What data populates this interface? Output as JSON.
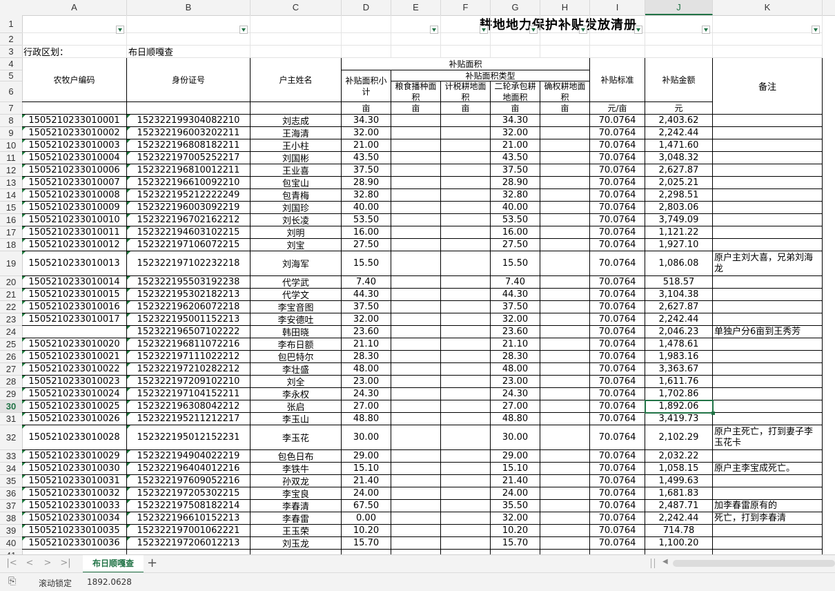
{
  "columns": [
    "A",
    "B",
    "C",
    "D",
    "E",
    "F",
    "G",
    "H",
    "I",
    "J",
    "K"
  ],
  "selected_column": "J",
  "selected_row": "30",
  "title": "耕地地力保护补贴发放清册",
  "region_label": "行政区划：",
  "region_value": "布日顺嘎查",
  "headers": {
    "farmer_code": "农牧户编码",
    "id_number": "身份证号",
    "head_name": "户主姓名",
    "subsidy_area": "补贴面积",
    "area_subtotal": "补贴面积小计",
    "area_type": "补贴面积类型",
    "grain_area": "粮食播种面积",
    "tax_area": "计税耕地面积",
    "contract_area": "二轮承包耕地面积",
    "right_area": "确权耕地面积",
    "standard": "补贴标准",
    "amount": "补贴金额",
    "remark": "备注",
    "unit_mu": "亩",
    "unit_yuan_mu": "元/亩",
    "unit_yuan": "元"
  },
  "rows": [
    {
      "r": "8",
      "code": "1505210233010001",
      "id": "152322199304082210",
      "name": "刘志成",
      "d": "34.30",
      "g": "34.30",
      "i": "70.0764",
      "j": "2,403.62",
      "k": ""
    },
    {
      "r": "9",
      "code": "1505210233010002",
      "id": "152322196003202211",
      "name": "王海清",
      "d": "32.00",
      "g": "32.00",
      "i": "70.0764",
      "j": "2,242.44",
      "k": ""
    },
    {
      "r": "10",
      "code": "1505210233010003",
      "id": "152322196808182211",
      "name": "王小柱",
      "d": "21.00",
      "g": "21.00",
      "i": "70.0764",
      "j": "1,471.60",
      "k": ""
    },
    {
      "r": "11",
      "code": "1505210233010004",
      "id": "152322197005252217",
      "name": "刘国彬",
      "d": "43.50",
      "g": "43.50",
      "i": "70.0764",
      "j": "3,048.32",
      "k": ""
    },
    {
      "r": "12",
      "code": "1505210233010006",
      "id": "152322196810012211",
      "name": "王业喜",
      "d": "37.50",
      "g": "37.50",
      "i": "70.0764",
      "j": "2,627.87",
      "k": ""
    },
    {
      "r": "13",
      "code": "1505210233010007",
      "id": "152322196610092210",
      "name": "包宝山",
      "d": "28.90",
      "g": "28.90",
      "i": "70.0764",
      "j": "2,025.21",
      "k": ""
    },
    {
      "r": "14",
      "code": "1505210233010008",
      "id": "152322195212222249",
      "name": "包青梅",
      "d": "32.80",
      "g": "32.80",
      "i": "70.0764",
      "j": "2,298.51",
      "k": ""
    },
    {
      "r": "15",
      "code": "1505210233010009",
      "id": "152322196003092219",
      "name": "刘国珍",
      "d": "40.00",
      "g": "40.00",
      "i": "70.0764",
      "j": "2,803.06",
      "k": ""
    },
    {
      "r": "16",
      "code": "1505210233010010",
      "id": "152322196702162212",
      "name": "刘长凌",
      "d": "53.50",
      "g": "53.50",
      "i": "70.0764",
      "j": "3,749.09",
      "k": ""
    },
    {
      "r": "17",
      "code": "1505210233010011",
      "id": "152322194603102215",
      "name": "刘明",
      "d": "16.00",
      "g": "16.00",
      "i": "70.0764",
      "j": "1,121.22",
      "k": ""
    },
    {
      "r": "18",
      "code": "1505210233010012",
      "id": "152322197106072215",
      "name": "刘宝",
      "d": "27.50",
      "g": "27.50",
      "i": "70.0764",
      "j": "1,927.10",
      "k": ""
    },
    {
      "r": "19",
      "code": "1505210233010013",
      "id": "152322197102232218",
      "name": "刘海军",
      "d": "15.50",
      "g": "15.50",
      "i": "70.0764",
      "j": "1,086.08",
      "k": "原户主刘大喜，兄弟刘海龙"
    },
    {
      "r": "20",
      "code": "1505210233010014",
      "id": "152322195503192238",
      "name": "代学武",
      "d": "7.40",
      "g": "7.40",
      "i": "70.0764",
      "j": "518.57",
      "k": ""
    },
    {
      "r": "21",
      "code": "1505210233010015",
      "id": "152322195302182213",
      "name": "代学文",
      "d": "44.30",
      "g": "44.30",
      "i": "70.0764",
      "j": "3,104.38",
      "k": ""
    },
    {
      "r": "22",
      "code": "1505210233010016",
      "id": "152322196206072218",
      "name": "李宝音图",
      "d": "37.50",
      "g": "37.50",
      "i": "70.0764",
      "j": "2,627.87",
      "k": ""
    },
    {
      "r": "23",
      "code": "1505210233010017",
      "id": "152322195001152213",
      "name": "李安德吐",
      "d": "32.00",
      "g": "32.00",
      "i": "70.0764",
      "j": "2,242.44",
      "k": ""
    },
    {
      "r": "24",
      "code": "",
      "id": "152322196507102222",
      "name": "韩田晓",
      "d": "23.60",
      "g": "23.60",
      "i": "70.0764",
      "j": "2,046.23",
      "k": "单独户分6亩到王秀芳"
    },
    {
      "r": "25",
      "code": "1505210233010020",
      "id": "152322196811072216",
      "name": "李布日额",
      "d": "21.10",
      "g": "21.10",
      "i": "70.0764",
      "j": "1,478.61",
      "k": ""
    },
    {
      "r": "26",
      "code": "1505210233010021",
      "id": "152322197111022212",
      "name": "包巴特尔",
      "d": "28.30",
      "g": "28.30",
      "i": "70.0764",
      "j": "1,983.16",
      "k": ""
    },
    {
      "r": "27",
      "code": "1505210233010022",
      "id": "152322197210282212",
      "name": "李壮盛",
      "d": "48.00",
      "g": "48.00",
      "i": "70.0764",
      "j": "3,363.67",
      "k": ""
    },
    {
      "r": "28",
      "code": "1505210233010023",
      "id": "152322197209102210",
      "name": "刘全",
      "d": "23.00",
      "g": "23.00",
      "i": "70.0764",
      "j": "1,611.76",
      "k": ""
    },
    {
      "r": "29",
      "code": "1505210233010024",
      "id": "152322197104152211",
      "name": "李永权",
      "d": "24.30",
      "g": "24.30",
      "i": "70.0764",
      "j": "1,702.86",
      "k": ""
    },
    {
      "r": "30",
      "code": "1505210233010025",
      "id": "152322196308042212",
      "name": "张启",
      "d": "27.00",
      "g": "27.00",
      "i": "70.0764",
      "j": "1,892.06",
      "k": ""
    },
    {
      "r": "31",
      "code": "1505210233010026",
      "id": "152322195211212217",
      "name": "李玉山",
      "d": "48.80",
      "g": "48.80",
      "i": "70.0764",
      "j": "3,419.73",
      "k": ""
    },
    {
      "r": "32",
      "code": "1505210233010028",
      "id": "152322195012152231",
      "name": "李玉花",
      "d": "30.00",
      "g": "30.00",
      "i": "70.0764",
      "j": "2,102.29",
      "k": "原户主死亡，打到妻子李玉花卡"
    },
    {
      "r": "33",
      "code": "1505210233010029",
      "id": "152322194904022219",
      "name": "包色日布",
      "d": "29.00",
      "g": "29.00",
      "i": "70.0764",
      "j": "2,032.22",
      "k": ""
    },
    {
      "r": "34",
      "code": "1505210233010030",
      "id": "152322196404012216",
      "name": "李铁牛",
      "d": "15.10",
      "g": "15.10",
      "i": "70.0764",
      "j": "1,058.15",
      "k": "原户主李宝成死亡。"
    },
    {
      "r": "35",
      "code": "1505210233010031",
      "id": "152322197609052216",
      "name": "孙双龙",
      "d": "21.40",
      "g": "21.40",
      "i": "70.0764",
      "j": "1,499.63",
      "k": ""
    },
    {
      "r": "36",
      "code": "1505210233010032",
      "id": "152322197205302215",
      "name": "李宝良",
      "d": "24.00",
      "g": "24.00",
      "i": "70.0764",
      "j": "1,681.83",
      "k": ""
    },
    {
      "r": "37",
      "code": "1505210233010033",
      "id": "152322197508182214",
      "name": "李春清",
      "d": "67.50",
      "g": "35.50",
      "i": "70.0764",
      "j": "2,487.71",
      "k": "加李春雷原有的"
    },
    {
      "r": "38",
      "code": "1505210233010034",
      "id": "152322196610152213",
      "name": "李春雷",
      "d": "0.00",
      "g": "32.00",
      "i": "70.0764",
      "j": "2,242.44",
      "k": "死亡，打到李春清"
    },
    {
      "r": "39",
      "code": "1505210233010035",
      "id": "152322197001062221",
      "name": "王玉荣",
      "d": "10.20",
      "g": "10.20",
      "i": "70.0764",
      "j": "714.78",
      "k": ""
    },
    {
      "r": "40",
      "code": "1505210233010036",
      "id": "152322197206012213",
      "name": "刘玉龙",
      "d": "15.70",
      "g": "15.70",
      "i": "70.0764",
      "j": "1,100.20",
      "k": ""
    }
  ],
  "partial_row_number": "41",
  "sheet_tab": "布日顺嘎查",
  "status": {
    "scroll_lock": "滚动锁定",
    "value": "1892.0628"
  },
  "colors": {
    "accent": "#217346",
    "marker": "#1e7b3e"
  }
}
